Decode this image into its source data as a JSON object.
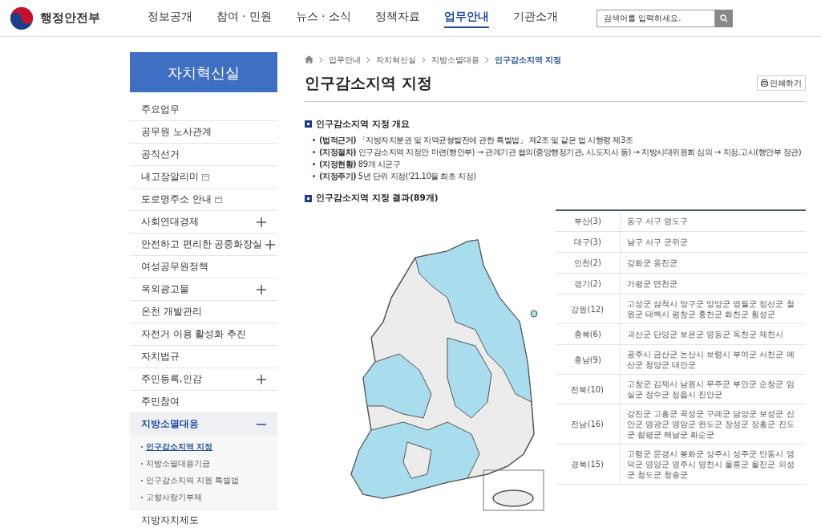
{
  "header": {
    "logo_text": "행정안전부",
    "nav": [
      {
        "label": "정보공개",
        "selected": false
      },
      {
        "label": "참여 · 민원",
        "selected": false
      },
      {
        "label": "뉴스 · 소식",
        "selected": false
      },
      {
        "label": "정책자료",
        "selected": false
      },
      {
        "label": "업무안내",
        "selected": true
      },
      {
        "label": "기관소개",
        "selected": false
      }
    ],
    "search": {
      "placeholder": "검색어를 입력하세요."
    }
  },
  "sidebar": {
    "title": "자치혁신실",
    "items": [
      {
        "label": "주요업무",
        "kind": "plain",
        "selected": false
      },
      {
        "label": "공무원 노사관계",
        "kind": "plain",
        "selected": false
      },
      {
        "label": "공직선거",
        "kind": "plain",
        "selected": false
      },
      {
        "label": "내고장알리미",
        "kind": "external",
        "selected": false
      },
      {
        "label": "도로명주소 안내",
        "kind": "external",
        "selected": false
      },
      {
        "label": "사회연대경제",
        "kind": "expandable",
        "expanded": false,
        "selected": false
      },
      {
        "label": "안전하고 편리한 공중화장실",
        "kind": "expandable",
        "expanded": false,
        "selected": false
      },
      {
        "label": "여성공무원정책",
        "kind": "plain",
        "selected": false
      },
      {
        "label": "옥외광고물",
        "kind": "expandable",
        "expanded": false,
        "selected": false
      },
      {
        "label": "온천 개발관리",
        "kind": "plain",
        "selected": false
      },
      {
        "label": "자전거 이용 활성화 추진",
        "kind": "plain",
        "selected": false
      },
      {
        "label": "자치법규",
        "kind": "plain",
        "selected": false
      },
      {
        "label": "주민등록,인감",
        "kind": "expandable",
        "expanded": false,
        "selected": false
      },
      {
        "label": "주민참여",
        "kind": "plain",
        "selected": false
      },
      {
        "label": "지방소멸대응",
        "kind": "expandable",
        "expanded": true,
        "selected": true,
        "children": [
          {
            "label": "인구감소지역 지정",
            "selected": true
          },
          {
            "label": "지방소멸대응기금",
            "selected": false
          },
          {
            "label": "인구감소지역 지원 특별법",
            "selected": false
          },
          {
            "label": "고향사랑기부제",
            "selected": false
          }
        ]
      },
      {
        "label": "지방자치제도",
        "kind": "plain",
        "selected": false
      }
    ]
  },
  "breadcrumb": [
    "업무안내",
    "자치혁신실",
    "지방소멸대응",
    "인구감소지역 지정"
  ],
  "page_title": "인구감소지역 지정",
  "print_button": "인쇄하기",
  "sections": [
    {
      "heading": "인구감소지역 지정 개요",
      "bullets": [
        "**(법적근거)** 「지방자치분권 및 지역균형발전에 관한 특별법」 제2조 및 같은 법 시행령 제3조",
        "**(지정절차)** 인구감소지역 지정안 마련(행안부) → 관계기관 협의(중앙행정기관, 시.도지사 등) → 지방시대위원회 심의 → 지정.고시(행안부 장관)",
        "**(지정현황)** 89개 시군구",
        "**(지정주기)** 5년 단위 지정('21.10월 최초 지정)"
      ]
    },
    {
      "heading": "인구감소지역 지정 결과(89개)"
    }
  ],
  "table": {
    "rows": [
      {
        "region": "부산(3)",
        "areas": "동구 서구 영도구"
      },
      {
        "region": "대구(3)",
        "areas": "남구 서구 군위군"
      },
      {
        "region": "인천(2)",
        "areas": "강화군 옹진군"
      },
      {
        "region": "경기(2)",
        "areas": "가평군 연천군"
      },
      {
        "region": "강원(12)",
        "areas": "고성군 삼척시 양구군 양양군 영월군 정선군 철원군 태백시 평창군 홍천군 화천군 횡성군"
      },
      {
        "region": "충북(6)",
        "areas": "괴산군 단양군 보은군 영동군 옥천군 제천시"
      },
      {
        "region": "충남(9)",
        "areas": "공주시 금산군 논산시 보령시 부여군 서천군 예산군 청양군 태안군"
      },
      {
        "region": "전북(10)",
        "areas": "고창군 김제시 남원시 무주군 부안군 순창군 임실군 장수군 정읍시 진안군"
      },
      {
        "region": "전남(16)",
        "areas": "강진군 고흥군 곡성군 구례군 담양군 보성군 신안군 영광군 영암군 완도군 장성군 장흥군 진도군 함평군 해남군 화순군"
      },
      {
        "region": "경북(15)",
        "areas": "고령군 문경시 봉화군 상주시 성주군 안동시 영덕군 영양군 영주시 영천시 울릉군 울진군 의성군 청도군 청송군"
      }
    ]
  }
}
